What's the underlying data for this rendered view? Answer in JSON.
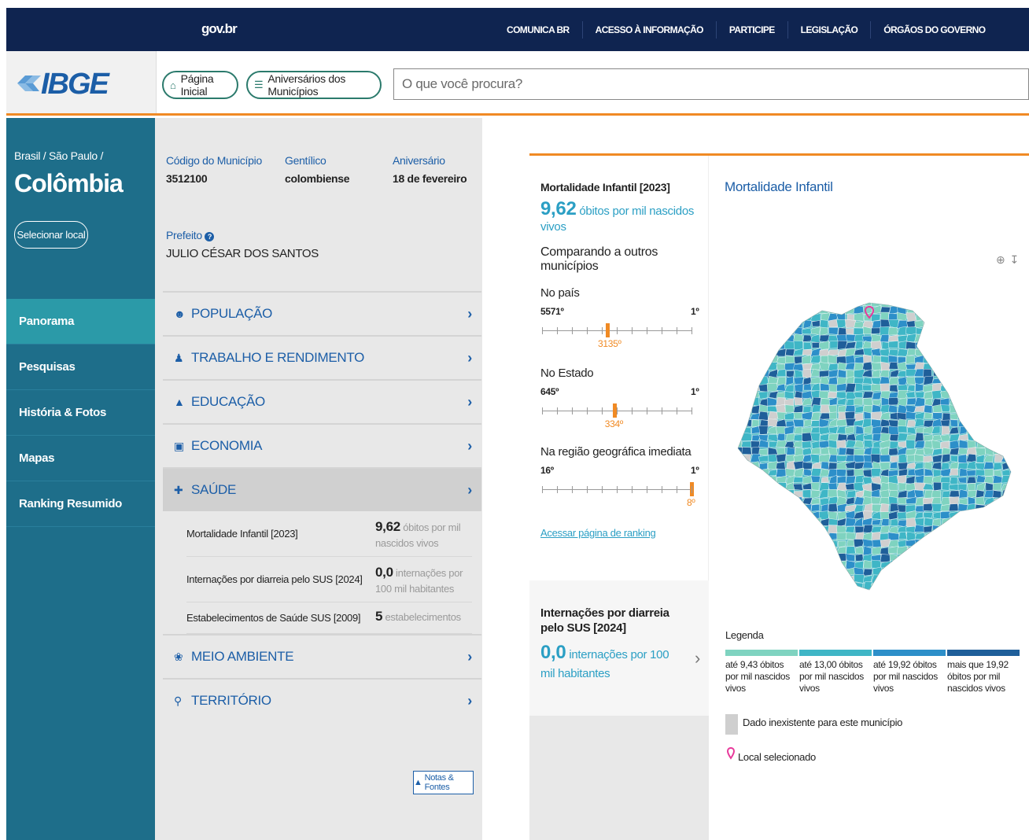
{
  "govbar": {
    "logo": "gov.br",
    "links": [
      "COMUNICA BR",
      "ACESSO À INFORMAÇÃO",
      "PARTICIPE",
      "LEGISLAÇÃO",
      "ÓRGÃOS DO GOVERNO"
    ]
  },
  "header": {
    "logo": "IBGE",
    "home_label": "Página Inicial",
    "aniv_label": "Aniversários dos Municípios",
    "search_placeholder": "O que você procura?"
  },
  "sidebar": {
    "breadcrumb": "Brasil / São Paulo /",
    "city": "Colômbia",
    "select_label": "Selecionar local",
    "items": [
      {
        "label": "Panorama",
        "active": true
      },
      {
        "label": "Pesquisas"
      },
      {
        "label": "História & Fotos"
      },
      {
        "label": "Mapas"
      },
      {
        "label": "Ranking Resumido"
      }
    ]
  },
  "info": {
    "codigo_label": "Código do Município",
    "codigo_value": "3512100",
    "gentilico_label": "Gentílico",
    "gentilico_value": "colombiense",
    "aniversario_label": "Aniversário",
    "aniversario_value": "18 de fevereiro",
    "prefeito_label": "Prefeito",
    "prefeito_value": "JULIO CÉSAR DOS SANTOS"
  },
  "accordion": {
    "top": [
      {
        "label": "POPULAÇÃO",
        "icon": "people-icon"
      },
      {
        "label": "TRABALHO E RENDIMENTO",
        "icon": "worker-icon"
      },
      {
        "label": "EDUCAÇÃO",
        "icon": "graduation-icon"
      },
      {
        "label": "ECONOMIA",
        "icon": "money-icon"
      }
    ],
    "open": {
      "label": "SAÚDE",
      "icon": "health-icon"
    },
    "saude_items": [
      {
        "label": "Mortalidade Infantil [2023]",
        "value": "9,62",
        "unit": "óbitos por mil nascidos vivos"
      },
      {
        "label": "Internações por diarreia pelo SUS [2024]",
        "value": "0,0",
        "unit": "internações por 100 mil habitantes"
      },
      {
        "label": "Estabelecimentos de Saúde SUS [2009]",
        "value": "5",
        "unit": "estabelecimentos"
      }
    ],
    "bottom": [
      {
        "label": "MEIO AMBIENTE",
        "icon": "leaf-icon"
      },
      {
        "label": "TERRITÓRIO",
        "icon": "location-icon"
      }
    ],
    "notes_label": "Notas & Fontes"
  },
  "stat": {
    "title": "Mortalidade Infantil [2023]",
    "value": "9,62",
    "unit": "óbitos por mil nascidos vivos",
    "compare_label": "Comparando a outros municípios",
    "rankings": [
      {
        "label": "No país",
        "min": "5571º",
        "max": "1º",
        "pos": "3135º",
        "fraction": 0.437
      },
      {
        "label": "No Estado",
        "min": "645º",
        "max": "1º",
        "pos": "334º",
        "fraction": 0.483
      },
      {
        "label": "Na região geográfica imediata",
        "min": "16º",
        "max": "1º",
        "pos": "8º",
        "fraction": 1.0
      }
    ],
    "link": "Acessar página de ranking"
  },
  "second_stat": {
    "title": "Internações por diarreia pelo SUS [2024]",
    "value": "0,0",
    "unit": "internações por 100 mil habitantes"
  },
  "map": {
    "title": "Mortalidade Infantil",
    "legend_title": "Legenda",
    "legend": [
      {
        "label": "até 9,43 óbitos por mil nascidos vivos",
        "color": "#7fd3c0"
      },
      {
        "label": "até 13,00 óbitos por mil nascidos vivos",
        "color": "#3fb6c6"
      },
      {
        "label": "até 19,92 óbitos por mil nascidos vivos",
        "color": "#2d8fc9"
      },
      {
        "label": "mais que 19,92 óbitos por mil nascidos vivos",
        "color": "#1f5f9a"
      }
    ],
    "nodata_label": "Dado inexistente para este município",
    "pin_label": "Local selecionado"
  },
  "colors": {
    "accent_orange": "#f08a24",
    "brand_blue": "#1c5ea7",
    "sidebar_teal": "#1e6e8a",
    "link_cyan": "#2b9fc4"
  }
}
